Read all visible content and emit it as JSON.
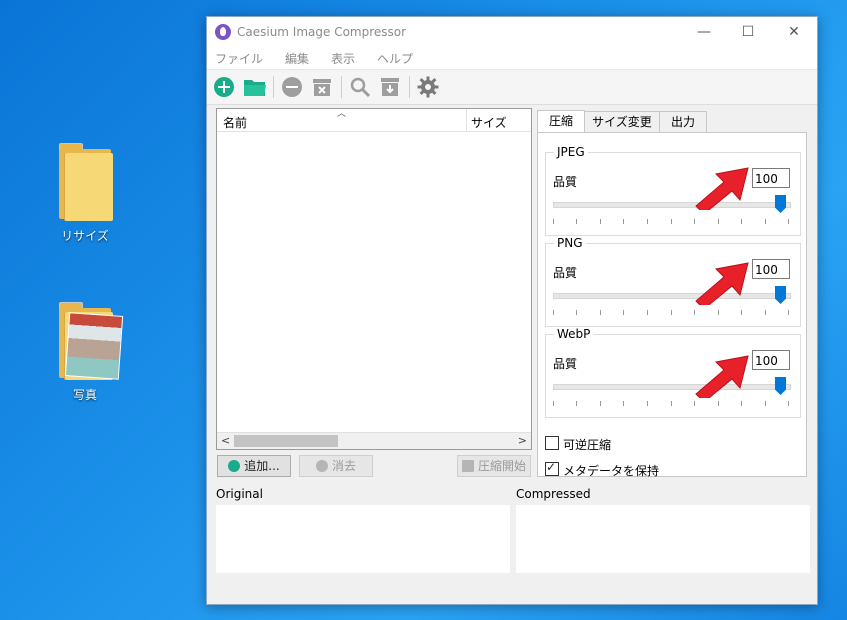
{
  "desktop": {
    "icons": [
      {
        "label": "リサイズ"
      },
      {
        "label": "写真"
      }
    ]
  },
  "window": {
    "title": "Caesium Image Compressor",
    "controls": {
      "minimize": "—",
      "maximize": "☐",
      "close": "✕"
    }
  },
  "menu": [
    "ファイル",
    "編集",
    "表示",
    "ヘルプ"
  ],
  "filelist": {
    "columns": {
      "name": "名前",
      "size": "サイズ"
    }
  },
  "buttons": {
    "add": "追加...",
    "remove": "消去",
    "compress": "圧縮開始"
  },
  "tabs": [
    "圧縮",
    "サイズ変更",
    "出力"
  ],
  "groups": [
    {
      "title": "JPEG",
      "quality_label": "品質",
      "quality": "100"
    },
    {
      "title": "PNG",
      "quality_label": "品質",
      "quality": "100"
    },
    {
      "title": "WebP",
      "quality_label": "品質",
      "quality": "100"
    }
  ],
  "options": {
    "lossless": {
      "label": "可逆圧縮",
      "checked": false
    },
    "keep_metadata": {
      "label": "メタデータを保持",
      "checked": true
    }
  },
  "preview": {
    "original": "Original",
    "compressed": "Compressed"
  },
  "colors": {
    "accent": "#0078d7",
    "add_green": "#1aab8a",
    "arrow_red": "#e8202a"
  }
}
